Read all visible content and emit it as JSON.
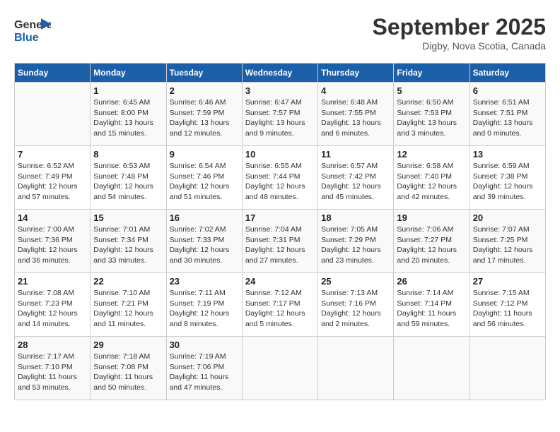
{
  "header": {
    "logo_line1": "General",
    "logo_line2": "Blue",
    "month": "September 2025",
    "location": "Digby, Nova Scotia, Canada"
  },
  "days_of_week": [
    "Sunday",
    "Monday",
    "Tuesday",
    "Wednesday",
    "Thursday",
    "Friday",
    "Saturday"
  ],
  "weeks": [
    [
      {
        "day": "",
        "info": ""
      },
      {
        "day": "1",
        "info": "Sunrise: 6:45 AM\nSunset: 8:00 PM\nDaylight: 13 hours\nand 15 minutes."
      },
      {
        "day": "2",
        "info": "Sunrise: 6:46 AM\nSunset: 7:59 PM\nDaylight: 13 hours\nand 12 minutes."
      },
      {
        "day": "3",
        "info": "Sunrise: 6:47 AM\nSunset: 7:57 PM\nDaylight: 13 hours\nand 9 minutes."
      },
      {
        "day": "4",
        "info": "Sunrise: 6:48 AM\nSunset: 7:55 PM\nDaylight: 13 hours\nand 6 minutes."
      },
      {
        "day": "5",
        "info": "Sunrise: 6:50 AM\nSunset: 7:53 PM\nDaylight: 13 hours\nand 3 minutes."
      },
      {
        "day": "6",
        "info": "Sunrise: 6:51 AM\nSunset: 7:51 PM\nDaylight: 13 hours\nand 0 minutes."
      }
    ],
    [
      {
        "day": "7",
        "info": "Sunrise: 6:52 AM\nSunset: 7:49 PM\nDaylight: 12 hours\nand 57 minutes."
      },
      {
        "day": "8",
        "info": "Sunrise: 6:53 AM\nSunset: 7:48 PM\nDaylight: 12 hours\nand 54 minutes."
      },
      {
        "day": "9",
        "info": "Sunrise: 6:54 AM\nSunset: 7:46 PM\nDaylight: 12 hours\nand 51 minutes."
      },
      {
        "day": "10",
        "info": "Sunrise: 6:55 AM\nSunset: 7:44 PM\nDaylight: 12 hours\nand 48 minutes."
      },
      {
        "day": "11",
        "info": "Sunrise: 6:57 AM\nSunset: 7:42 PM\nDaylight: 12 hours\nand 45 minutes."
      },
      {
        "day": "12",
        "info": "Sunrise: 6:58 AM\nSunset: 7:40 PM\nDaylight: 12 hours\nand 42 minutes."
      },
      {
        "day": "13",
        "info": "Sunrise: 6:59 AM\nSunset: 7:38 PM\nDaylight: 12 hours\nand 39 minutes."
      }
    ],
    [
      {
        "day": "14",
        "info": "Sunrise: 7:00 AM\nSunset: 7:36 PM\nDaylight: 12 hours\nand 36 minutes."
      },
      {
        "day": "15",
        "info": "Sunrise: 7:01 AM\nSunset: 7:34 PM\nDaylight: 12 hours\nand 33 minutes."
      },
      {
        "day": "16",
        "info": "Sunrise: 7:02 AM\nSunset: 7:33 PM\nDaylight: 12 hours\nand 30 minutes."
      },
      {
        "day": "17",
        "info": "Sunrise: 7:04 AM\nSunset: 7:31 PM\nDaylight: 12 hours\nand 27 minutes."
      },
      {
        "day": "18",
        "info": "Sunrise: 7:05 AM\nSunset: 7:29 PM\nDaylight: 12 hours\nand 23 minutes."
      },
      {
        "day": "19",
        "info": "Sunrise: 7:06 AM\nSunset: 7:27 PM\nDaylight: 12 hours\nand 20 minutes."
      },
      {
        "day": "20",
        "info": "Sunrise: 7:07 AM\nSunset: 7:25 PM\nDaylight: 12 hours\nand 17 minutes."
      }
    ],
    [
      {
        "day": "21",
        "info": "Sunrise: 7:08 AM\nSunset: 7:23 PM\nDaylight: 12 hours\nand 14 minutes."
      },
      {
        "day": "22",
        "info": "Sunrise: 7:10 AM\nSunset: 7:21 PM\nDaylight: 12 hours\nand 11 minutes."
      },
      {
        "day": "23",
        "info": "Sunrise: 7:11 AM\nSunset: 7:19 PM\nDaylight: 12 hours\nand 8 minutes."
      },
      {
        "day": "24",
        "info": "Sunrise: 7:12 AM\nSunset: 7:17 PM\nDaylight: 12 hours\nand 5 minutes."
      },
      {
        "day": "25",
        "info": "Sunrise: 7:13 AM\nSunset: 7:16 PM\nDaylight: 12 hours\nand 2 minutes."
      },
      {
        "day": "26",
        "info": "Sunrise: 7:14 AM\nSunset: 7:14 PM\nDaylight: 11 hours\nand 59 minutes."
      },
      {
        "day": "27",
        "info": "Sunrise: 7:15 AM\nSunset: 7:12 PM\nDaylight: 11 hours\nand 56 minutes."
      }
    ],
    [
      {
        "day": "28",
        "info": "Sunrise: 7:17 AM\nSunset: 7:10 PM\nDaylight: 11 hours\nand 53 minutes."
      },
      {
        "day": "29",
        "info": "Sunrise: 7:18 AM\nSunset: 7:08 PM\nDaylight: 11 hours\nand 50 minutes."
      },
      {
        "day": "30",
        "info": "Sunrise: 7:19 AM\nSunset: 7:06 PM\nDaylight: 11 hours\nand 47 minutes."
      },
      {
        "day": "",
        "info": ""
      },
      {
        "day": "",
        "info": ""
      },
      {
        "day": "",
        "info": ""
      },
      {
        "day": "",
        "info": ""
      }
    ]
  ]
}
